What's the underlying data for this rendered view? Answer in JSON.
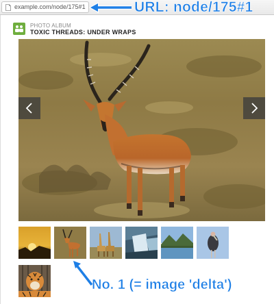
{
  "browser": {
    "url": "example.com/node/175#1",
    "page_icon": "document-icon"
  },
  "annotations": {
    "top_callout": "URL: node/175#1",
    "bottom_callout": "No. 1 (= image 'delta')",
    "color": "#1e7fe6"
  },
  "album": {
    "icon": "photo-album-icon",
    "label": "PHOTO ALBUM",
    "title": "TOXIC THREADS: UNDER WRAPS",
    "accent": "#6fae3e"
  },
  "slideshow": {
    "current_image": "impala-antelope-photo",
    "prev_icon": "chevron-left-icon",
    "next_icon": "chevron-right-icon"
  },
  "thumbnails": [
    {
      "subject": "sunset-thumbnail",
      "selected": false
    },
    {
      "subject": "impala-thumbnail",
      "selected": true
    },
    {
      "subject": "giraffes-thumbnail",
      "selected": false
    },
    {
      "subject": "waterfall-thumbnail",
      "selected": false
    },
    {
      "subject": "lake-mountains-thumbnail",
      "selected": false
    },
    {
      "subject": "marabou-stork-thumbnail",
      "selected": false
    },
    {
      "subject": "tiger-thumbnail",
      "selected": false
    }
  ]
}
